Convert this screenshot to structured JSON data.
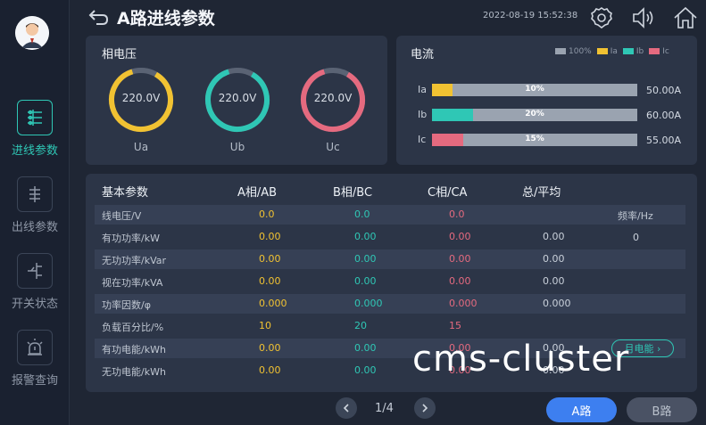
{
  "header": {
    "title": "A路进线参数",
    "datetime": "2022-08-19 15:52:38"
  },
  "sidebar": {
    "items": [
      {
        "label": "进线参数",
        "active": true,
        "icon": "incoming-line-icon"
      },
      {
        "label": "出线参数",
        "active": false,
        "icon": "outgoing-line-icon"
      },
      {
        "label": "开关状态",
        "active": false,
        "icon": "switch-status-icon"
      },
      {
        "label": "报警查询",
        "active": false,
        "icon": "alarm-icon"
      }
    ]
  },
  "phase_voltage": {
    "title": "相电压",
    "gauges": [
      {
        "name": "Ua",
        "value": "220.0V",
        "color": "#f1c232"
      },
      {
        "name": "Ub",
        "value": "220.0V",
        "color": "#2fc7b5"
      },
      {
        "name": "Uc",
        "value": "220.0V",
        "color": "#e56a7f"
      }
    ]
  },
  "current": {
    "title": "电流",
    "legend": [
      "100%",
      "Ia",
      "Ib",
      "Ic"
    ],
    "rows": [
      {
        "name": "Ia",
        "percent_label": "10%",
        "fraction": 0.1,
        "value": "50.00A",
        "color": "#f1c232"
      },
      {
        "name": "Ib",
        "percent_label": "20%",
        "fraction": 0.2,
        "value": "60.00A",
        "color": "#2fc7b5"
      },
      {
        "name": "Ic",
        "percent_label": "15%",
        "fraction": 0.15,
        "value": "55.00A",
        "color": "#e56a7f"
      }
    ]
  },
  "basic_params": {
    "headers": [
      "基本参数",
      "A相/AB",
      "B相/BC",
      "C相/CA",
      "总/平均"
    ],
    "rows": [
      {
        "label": "线电压/V",
        "a": "0.0",
        "b": "0.0",
        "c": "0.0",
        "t": ""
      },
      {
        "label": "有功功率/kW",
        "a": "0.00",
        "b": "0.00",
        "c": "0.00",
        "t": "0.00"
      },
      {
        "label": "无功功率/kVar",
        "a": "0.00",
        "b": "0.00",
        "c": "0.00",
        "t": "0.00"
      },
      {
        "label": "视在功率/kVA",
        "a": "0.00",
        "b": "0.00",
        "c": "0.00",
        "t": "0.00"
      },
      {
        "label": "功率因数/φ",
        "a": "0.000",
        "b": "0.000",
        "c": "0.000",
        "t": "0.000"
      },
      {
        "label": "负载百分比/%",
        "a": "10",
        "b": "20",
        "c": "15",
        "t": ""
      },
      {
        "label": "有功电能/kWh",
        "a": "0.00",
        "b": "0.00",
        "c": "0.00",
        "t": "0.00"
      },
      {
        "label": "无功电能/kWh",
        "a": "0.00",
        "b": "0.00",
        "c": "0.00",
        "t": "0.00"
      }
    ],
    "frequency_label": "频率/Hz",
    "frequency_value": "0",
    "month_energy_button": "月电能 ›"
  },
  "footer": {
    "page": "1/4",
    "route_a": "A路",
    "route_b": "B路"
  },
  "watermark": "cms-cluster"
}
